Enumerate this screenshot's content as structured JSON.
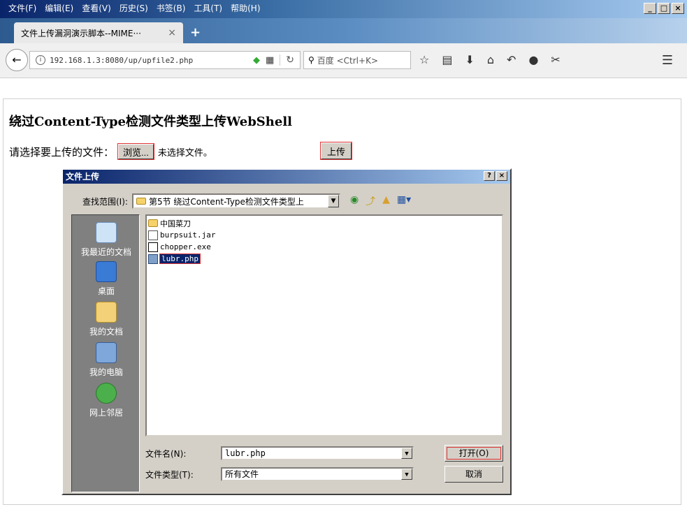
{
  "menubar": {
    "items": [
      "文件(F)",
      "编辑(E)",
      "查看(V)",
      "历史(S)",
      "书签(B)",
      "工具(T)",
      "帮助(H)"
    ]
  },
  "window_controls": [
    "_",
    "□",
    "×"
  ],
  "tab": {
    "title": "文件上传漏洞演示脚本--MIME···",
    "close": "×",
    "new_tab": "+"
  },
  "navbar": {
    "back": "←",
    "info": "i",
    "url": "192.168.1.3:8080/up/upfile2.php",
    "search_placeholder": "百度 <Ctrl+K>"
  },
  "page": {
    "heading": "绕过Content-Type检测文件类型上传WebShell",
    "upload_label": "请选择要上传的文件：",
    "browse_button": "浏览...",
    "no_file": "未选择文件。",
    "submit_button": "上传"
  },
  "dialog": {
    "title": "文件上传",
    "help": "?",
    "close": "×",
    "lookin_label": "查找范围(I):",
    "lookin_value": "第5节 绕过Content-Type检测文件类型上",
    "places": [
      "我最近的文档",
      "桌面",
      "我的文档",
      "我的电脑",
      "网上邻居"
    ],
    "files": [
      {
        "name": "中国菜刀",
        "type": "folder"
      },
      {
        "name": "burpsuit.jar",
        "type": "jar"
      },
      {
        "name": "chopper.exe",
        "type": "exe"
      },
      {
        "name": "lubr.php",
        "type": "php",
        "selected": true
      }
    ],
    "filename_label": "文件名(N):",
    "filename_value": "lubr.php",
    "filetype_label": "文件类型(T):",
    "filetype_value": "所有文件",
    "open_button": "打开(O)",
    "cancel_button": "取消"
  },
  "colors": {
    "titlebar_start": "#0a246a",
    "dialog_face": "#d4d0c8",
    "selection": "#0a246a",
    "highlight_outline": "#dd3333"
  }
}
